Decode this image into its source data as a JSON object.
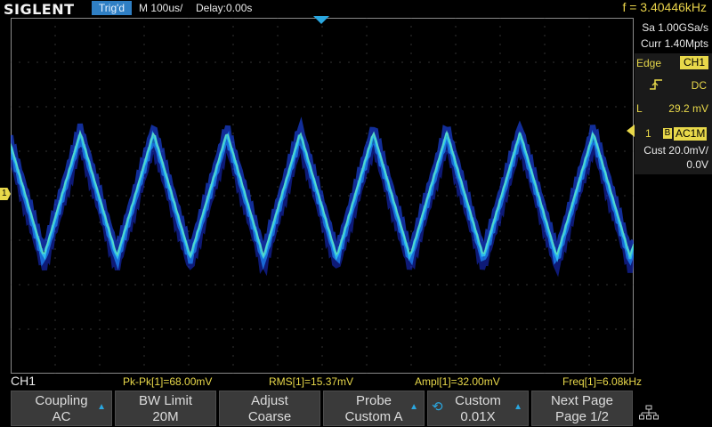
{
  "topbar": {
    "brand": "SIGLENT",
    "trigger_status": "Trig'd",
    "timebase": "M 100us/",
    "delay": "Delay:0.00s",
    "frequency": "f = 3.40446kHz"
  },
  "acquisition": {
    "sample_rate": "Sa 1.00GSa/s",
    "memory_depth": "Curr 1.40Mpts"
  },
  "trigger": {
    "type_label": "Edge",
    "source": "CH1",
    "slope_icon": "rising-edge-icon",
    "coupling": "DC",
    "level_label": "L",
    "level": "29.2 mV",
    "level_marker_color": "#e8d84a"
  },
  "channel": {
    "number": "1",
    "bw_badge": "B",
    "coupling_badge": "AC1M",
    "scale": "Cust 20.0mV/",
    "offset": "0.0V",
    "color": "#e8d84a",
    "ground_marker": "1"
  },
  "measurements": {
    "channel_label": "CH1",
    "pk_pk": "Pk-Pk[1]=68.00mV",
    "rms": "RMS[1]=15.37mV",
    "ampl": "Ampl[1]=32.00mV",
    "freq": "Freq[1]=6.08kHz"
  },
  "menu": {
    "coupling": {
      "title": "Coupling",
      "value": "AC"
    },
    "bw_limit": {
      "title": "BW Limit",
      "value": "20M"
    },
    "adjust": {
      "title": "Adjust",
      "value": "Coarse"
    },
    "probe": {
      "title": "Probe",
      "value": "Custom A"
    },
    "custom": {
      "title": "Custom",
      "value": "0.01X"
    },
    "next_page": {
      "title": "Next Page",
      "value": "Page 1/2"
    }
  },
  "icons": {
    "network": "network-icon",
    "knob": "rotary-knob-icon"
  },
  "colors": {
    "accent": "#2aa7e0",
    "trace_primary": "#1e6bff",
    "trace_highlight": "#3fd6e8",
    "label_yellow": "#e8d84a"
  },
  "waveform": {
    "shape": "triangle",
    "cycles_visible": 8.5
  }
}
